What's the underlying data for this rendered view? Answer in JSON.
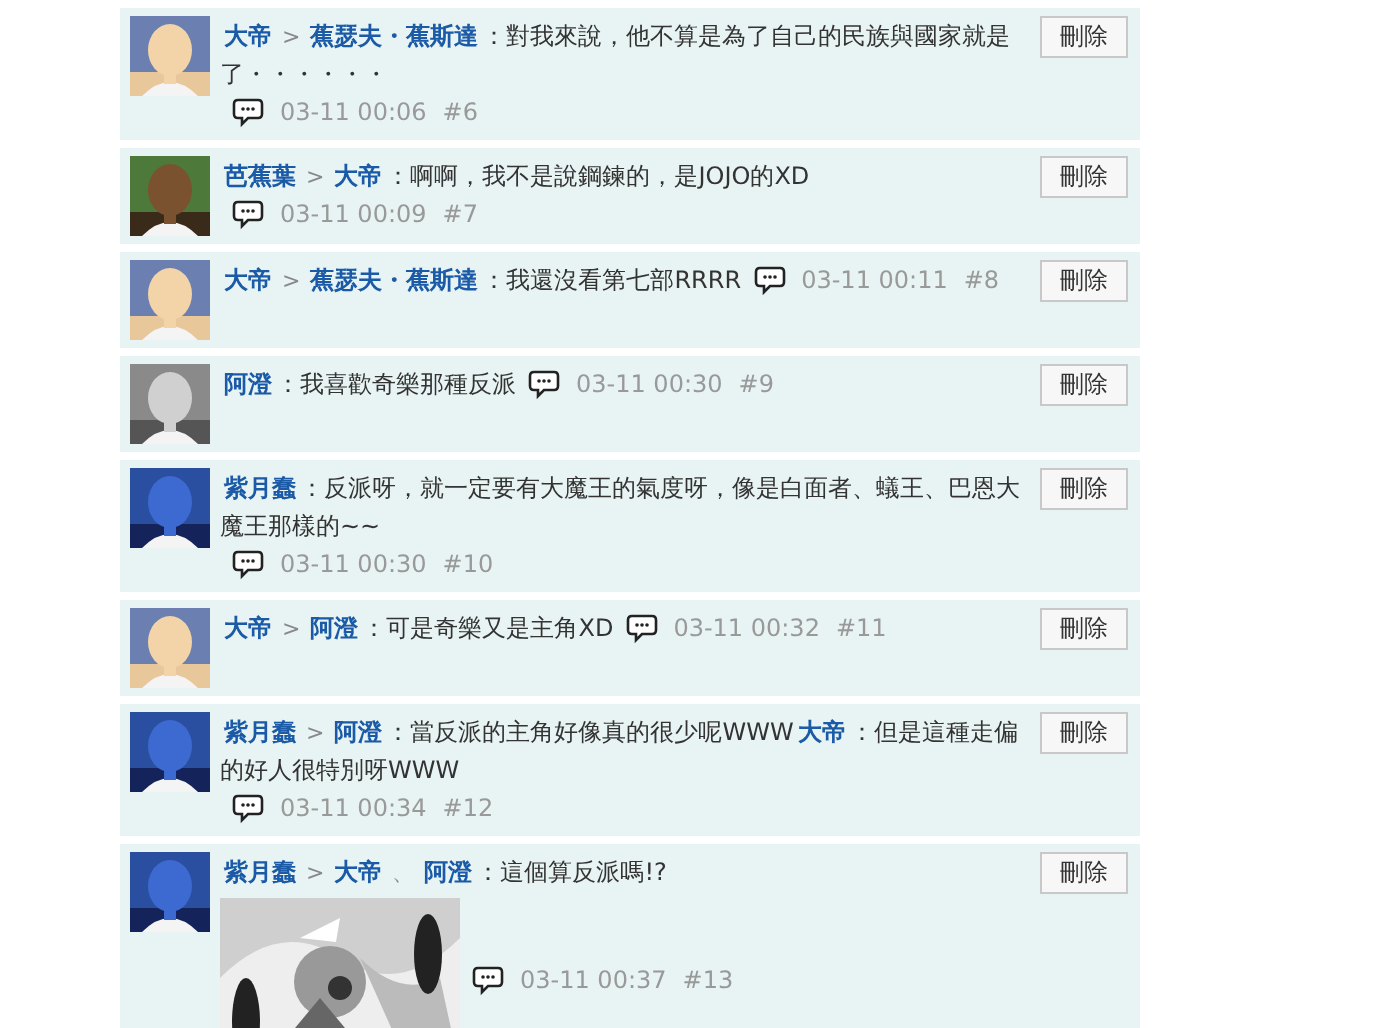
{
  "comments": [
    {
      "avatar": {
        "kind": "picture"
      },
      "body": [
        {
          "kind": "name",
          "text": "大帝"
        },
        {
          "kind": "sep",
          "text": ">"
        },
        {
          "kind": "name",
          "text": "蕉瑟夫・蕉斯達"
        },
        {
          "kind": "text",
          "text": "：對我來說，他不算是為了自己的民族與國家就是了・・・・・・"
        }
      ],
      "time": "03-11 00:06",
      "floor": "#6",
      "delete": "刪除"
    },
    {
      "avatar": {
        "kind": "picture"
      },
      "body": [
        {
          "kind": "name",
          "text": "芭蕉葉"
        },
        {
          "kind": "sep",
          "text": ">"
        },
        {
          "kind": "name",
          "text": "大帝"
        },
        {
          "kind": "text",
          "text": "：啊啊，我不是說鋼鍊的，是JOJO的XD"
        }
      ],
      "time": "03-11 00:09",
      "floor": "#7",
      "delete": "刪除"
    },
    {
      "avatar": {
        "kind": "picture"
      },
      "body": [
        {
          "kind": "name",
          "text": "大帝"
        },
        {
          "kind": "sep",
          "text": ">"
        },
        {
          "kind": "name",
          "text": "蕉瑟夫・蕉斯達"
        },
        {
          "kind": "text",
          "text": "：我還沒看第七部RRRR"
        }
      ],
      "time": "03-11 00:11",
      "floor": "#8",
      "delete": "刪除"
    },
    {
      "avatar": {
        "kind": "picture"
      },
      "body": [
        {
          "kind": "name",
          "text": "阿澄"
        },
        {
          "kind": "text",
          "text": "：我喜歡奇樂那種反派"
        }
      ],
      "time": "03-11 00:30",
      "floor": "#9",
      "delete": "刪除"
    },
    {
      "avatar": {
        "kind": "picture"
      },
      "body": [
        {
          "kind": "name",
          "text": "紫月蠢"
        },
        {
          "kind": "text",
          "text": "：反派呀，就一定要有大魔王的氣度呀，像是白面者、蟻王、巴恩大魔王那樣的~~"
        }
      ],
      "time": "03-11 00:30",
      "floor": "#10",
      "delete": "刪除"
    },
    {
      "avatar": {
        "kind": "picture"
      },
      "body": [
        {
          "kind": "name",
          "text": "大帝"
        },
        {
          "kind": "sep",
          "text": ">"
        },
        {
          "kind": "name",
          "text": "阿澄"
        },
        {
          "kind": "text",
          "text": "：可是奇樂又是主角XD"
        }
      ],
      "time": "03-11 00:32",
      "floor": "#11",
      "delete": "刪除"
    },
    {
      "avatar": {
        "kind": "picture"
      },
      "body": [
        {
          "kind": "name",
          "text": "紫月蠢"
        },
        {
          "kind": "sep",
          "text": ">"
        },
        {
          "kind": "name",
          "text": "阿澄"
        },
        {
          "kind": "text",
          "text": "：當反派的主角好像真的很少呢WWW"
        },
        {
          "kind": "name",
          "text": "大帝"
        },
        {
          "kind": "text",
          "text": "：但是這種走偏的好人很特別呀WWW"
        }
      ],
      "time": "03-11 00:34",
      "floor": "#12",
      "delete": "刪除"
    },
    {
      "avatar": {
        "kind": "picture"
      },
      "body": [
        {
          "kind": "name",
          "text": "紫月蠢"
        },
        {
          "kind": "sep",
          "text": ">"
        },
        {
          "kind": "name",
          "text": "大帝"
        },
        {
          "kind": "sep",
          "text": "、"
        },
        {
          "kind": "name",
          "text": "阿澄"
        },
        {
          "kind": "text",
          "text": "：這個算反派嗎!?"
        }
      ],
      "attachment": {
        "kind": "picture"
      },
      "time": "03-11 00:37",
      "floor": "#13",
      "delete": "刪除"
    }
  ]
}
